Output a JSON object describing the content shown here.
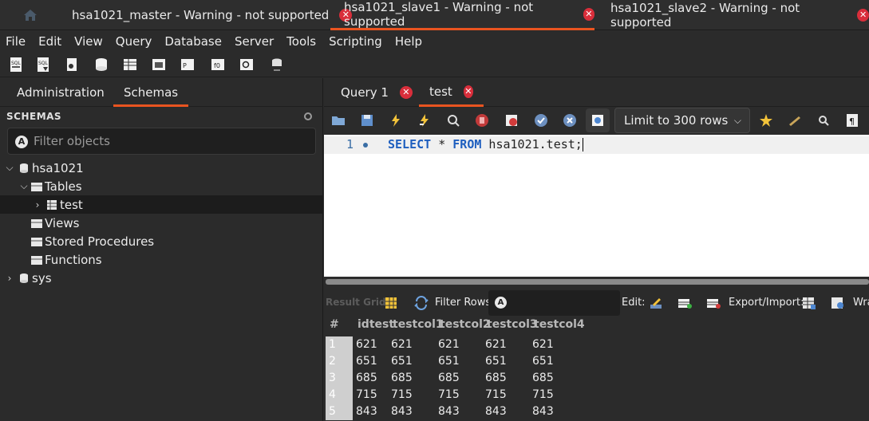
{
  "connection_tabs": [
    {
      "label": "hsa1021_master - Warning - not supported",
      "active": false
    },
    {
      "label": "hsa1021_slave1 - Warning - not supported",
      "active": true
    },
    {
      "label": "hsa1021_slave2 - Warning - not supported",
      "active": false
    }
  ],
  "close_glyph": "✕",
  "menu": [
    "File",
    "Edit",
    "View",
    "Query",
    "Database",
    "Server",
    "Tools",
    "Scripting",
    "Help"
  ],
  "sidebar": {
    "tabs": [
      "Administration",
      "Schemas"
    ],
    "active_tab": "Schemas",
    "header": "SCHEMAS",
    "filter_placeholder": "Filter objects",
    "tree": {
      "schema": "hsa1021",
      "tables": "Tables",
      "table_test": "test",
      "views": "Views",
      "procedures": "Stored Procedures",
      "functions": "Functions",
      "sys": "sys"
    }
  },
  "query_tabs": [
    {
      "label": "Query 1",
      "active": false
    },
    {
      "label": "test",
      "active": true
    }
  ],
  "query_toolbar": {
    "limit_label": "Limit to 300 rows"
  },
  "editor": {
    "line_number": "1",
    "kw_select": "SELECT",
    "star": " * ",
    "kw_from": "FROM",
    "rest": " hsa1021.test;"
  },
  "results_toolbar": {
    "result_grid": "Result Grid",
    "filter_rows": "Filter Rows:",
    "edit": "Edit:",
    "export_import": "Export/Import:",
    "wrap": "Wra"
  },
  "grid": {
    "columns": [
      "#",
      "idtest",
      "testcol1",
      "testcol2",
      "testcol3",
      "testcol4"
    ],
    "rows": [
      [
        "1",
        "621",
        "621",
        "621",
        "621",
        "621"
      ],
      [
        "2",
        "651",
        "651",
        "651",
        "651",
        "651"
      ],
      [
        "3",
        "685",
        "685",
        "685",
        "685",
        "685"
      ],
      [
        "4",
        "715",
        "715",
        "715",
        "715",
        "715"
      ],
      [
        "5",
        "843",
        "843",
        "843",
        "843",
        "843"
      ]
    ]
  },
  "colors": {
    "accent": "#e95420",
    "close": "#d92e3b",
    "keyword": "#1e5fbf"
  }
}
